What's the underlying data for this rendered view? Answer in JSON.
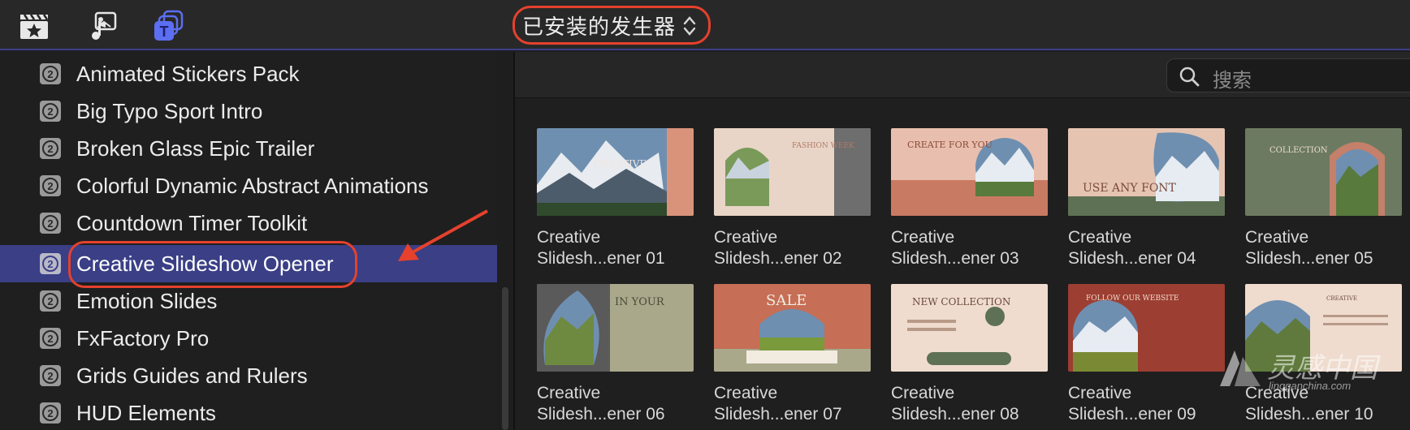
{
  "toolbar": {
    "tools": [
      {
        "icon": "clapper-star-icon"
      },
      {
        "icon": "music-photo-icon"
      },
      {
        "icon": "titles-generators-icon"
      }
    ],
    "selector_label": "已安装的发生器",
    "accent": "#e5412d"
  },
  "sidebar": {
    "items": [
      {
        "label": "Animated Stickers Pack"
      },
      {
        "label": "Big Typo Sport Intro"
      },
      {
        "label": "Broken Glass Epic Trailer"
      },
      {
        "label": "Colorful Dynamic Abstract Animations"
      },
      {
        "label": "Countdown Timer Toolkit"
      },
      {
        "label": "Creative Slideshow Opener",
        "selected": true
      },
      {
        "label": "Emotion Slides"
      },
      {
        "label": "FxFactory Pro"
      },
      {
        "label": "Grids Guides and Rulers"
      },
      {
        "label": "HUD Elements"
      }
    ],
    "selected_color": "#3a3f86"
  },
  "browser": {
    "search_placeholder": "搜索",
    "tiles": [
      {
        "line1": "Creative",
        "line2": "Slidesh...ener 01",
        "thumb_text": "CREATIVE"
      },
      {
        "line1": "Creative",
        "line2": "Slidesh...ener 02",
        "thumb_text": "FASHION WEEK"
      },
      {
        "line1": "Creative",
        "line2": "Slidesh...ener 03",
        "thumb_text": "CREATE FOR YOU"
      },
      {
        "line1": "Creative",
        "line2": "Slidesh...ener 04",
        "thumb_text": "USE ANY FONT"
      },
      {
        "line1": "Creative",
        "line2": "Slidesh...ener 05",
        "thumb_text": "COLLECTION"
      },
      {
        "line1": "Creative",
        "line2": "Slidesh...ener 06",
        "thumb_text": "IN YOUR"
      },
      {
        "line1": "Creative",
        "line2": "Slidesh...ener 07",
        "thumb_text": "SALE"
      },
      {
        "line1": "Creative",
        "line2": "Slidesh...ener 08",
        "thumb_text": "NEW COLLECTION"
      },
      {
        "line1": "Creative",
        "line2": "Slidesh...ener 09",
        "thumb_text": "FOLLOW OUR WEBSITE"
      },
      {
        "line1": "Creative",
        "line2": "Slidesh...ener 10",
        "thumb_text": "CREATIVE"
      }
    ]
  },
  "watermark": {
    "text": "灵感中国",
    "url": "lingganchina.com"
  }
}
